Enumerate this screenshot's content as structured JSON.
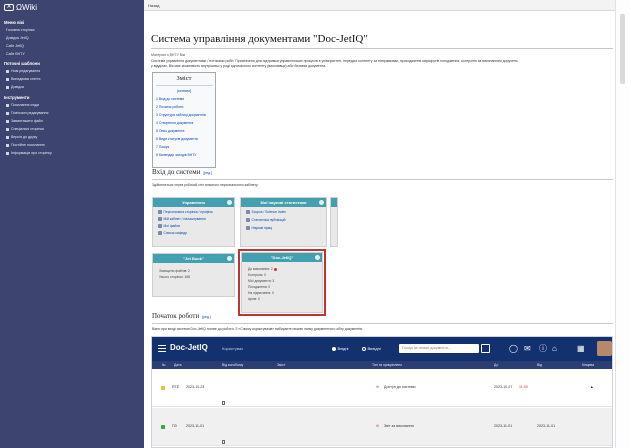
{
  "wiki": {
    "logo_text": "ΩWiki",
    "logo_mark": "A",
    "topbar_back": "Назад"
  },
  "sidebar": {
    "sections": [
      {
        "label": "Меню вікі"
      },
      {
        "label": "Поточні шаблони"
      },
      {
        "label": "Інструменти"
      }
    ],
    "nav_items": [
      {
        "label": "Головна сторінка"
      },
      {
        "label": "Довідка JetIQ"
      },
      {
        "label": "Сайт JetIQ"
      },
      {
        "label": "Сайт ВНТУ"
      }
    ],
    "template_items": [
      {
        "label": "Нові редагування"
      },
      {
        "label": "Випадкова стаття"
      },
      {
        "label": "Довідка"
      }
    ],
    "tool_items": [
      {
        "label": "Посилання сюди"
      },
      {
        "label": "Пов'язані редагування"
      },
      {
        "label": "Завантажити файл"
      },
      {
        "label": "Спеціальні сторінки"
      },
      {
        "label": "Версія до друку"
      },
      {
        "label": "Постійне посилання"
      },
      {
        "label": "Інформація про сторінку"
      }
    ]
  },
  "page": {
    "title": "Система управління документами \"Doc-JetIQ\"",
    "subtitle": "Матеріал з ВНТУ Вікі",
    "intro_line1": "Система управління документами / потоками робіт. Призначена для підтримки управлінських процесів в університеті, передачі контенту за напрямками, проходження маршрутів погодження, контролю за виконанням доручень",
    "intro_line2": "у відділах. Вік має можливість внутрішньо у роді одночасного контенту (виконавця) або безпеки документа."
  },
  "toc": {
    "title": "Зміст",
    "toggle": "[сховати]",
    "items": [
      "1 Вхід до системи",
      "2 Початок роботи",
      "3 Структура таблиці документів",
      "4 Створення документа",
      "5 Опис документа",
      "6 Види статусів документа",
      "7 Пошук",
      "8 Календар заходів ВНТУ"
    ]
  },
  "login_section": {
    "title": "Вхід до системи",
    "edit": "[ред.]",
    "note": "Здійснюється через робочий стіл власного персонального кабінету."
  },
  "cards": {
    "management": {
      "title": "Управління",
      "rows": [
        "Персональна сторінка / профіль",
        "Мій кабінет / налаштування",
        "Мої файли",
        "Список кафедр"
      ]
    },
    "statistics": {
      "title": "Мої наукові статистики",
      "rows": [
        "Scopus / Science Index",
        "Статистика публікацій",
        "Наукові праці"
      ]
    },
    "jetbook": {
      "title": "\"Jet Book\"",
      "lines": [
        "Захищено файлів: 2",
        "Усього сторінок: 168"
      ]
    },
    "docjetiq": {
      "title": "\"Doc-JetIQ\"",
      "lines": [
        "До виконання: 2",
        "Контроль: 0",
        "Мої документи: 3",
        "Погодження: 0",
        "На підписання: 0",
        "Архів: 0"
      ]
    }
  },
  "start_section": {
    "title": "Початок роботи",
    "edit": "[ред.]",
    "note": "Вікно при вході системи Doc-JetIQ готове до роботи. З «Списку користувачів» вибираєте нижню ланку документного обігу документів."
  },
  "app": {
    "brand": "Doc-JetIQ",
    "user": "Користувач",
    "radio_1": "Вхідні",
    "radio_2": "Вихідні",
    "search_placeholder": "Пошук за темою документа...",
    "headers": [
      "№",
      "Дата",
      "Від кого/Кому",
      "Зміст",
      "Тип та прикріплено",
      "До",
      "Від",
      "Кінцева"
    ],
    "rows": [
      {
        "num": "RTE",
        "date": "2023-10-24",
        "text": "Доступ до системи",
        "due": "2023-10-27",
        "due_time": "11:00"
      },
      {
        "num": "ПЗ",
        "date": "2023-11-01",
        "text": "Звіт за виконання",
        "due": "2023-11-01",
        "to": "2023-11-01"
      }
    ]
  },
  "colors": {
    "sidebar_bg": "#3d4470",
    "card_header": "#43a0b0",
    "highlight": "#c4332f",
    "app_nav": "#13316f",
    "status_yellow": "#f0c12e",
    "status_green": "#3aa845"
  }
}
